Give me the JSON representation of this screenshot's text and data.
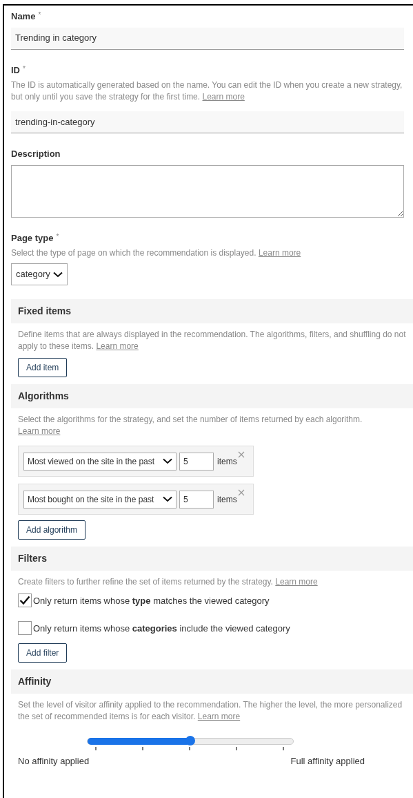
{
  "name_field": {
    "label": "Name",
    "required_mark": "*",
    "value": "Trending in category"
  },
  "id_field": {
    "label": "ID",
    "required_mark": "*",
    "help": "The ID is automatically generated based on the name. You can edit the ID when you create a new strategy, but only until you save the strategy for the first time.",
    "link": "Learn more",
    "value": "trending-in-category"
  },
  "description_field": {
    "label": "Description"
  },
  "page_type": {
    "label": "Page type",
    "required_mark": "*",
    "help": "Select the type of page on which the recommendation is displayed.",
    "link": "Learn more",
    "value": "category"
  },
  "fixed_items": {
    "title": "Fixed items",
    "help": "Define items that are always displayed in the recommendation. The algorithms, filters, and shuffling do not apply to these items.",
    "link": "Learn more",
    "button": "Add item"
  },
  "algorithms": {
    "title": "Algorithms",
    "help": "Select the algorithms for the strategy, and set the number of items returned by each algorithm.",
    "link": "Learn more",
    "rows": [
      {
        "algorithm": "Most viewed on the site in the past",
        "count": "5",
        "unit": "items"
      },
      {
        "algorithm": "Most bought on the site in the past",
        "count": "5",
        "unit": "items"
      }
    ],
    "button": "Add algorithm"
  },
  "filters": {
    "title": "Filters",
    "help": "Create filters to further refine the set of items returned by the strategy.",
    "link": "Learn more",
    "options": [
      {
        "label": "Only return items whose **type** matches the viewed category",
        "checked": true
      },
      {
        "label": "Only return items whose **categories** include the viewed category",
        "checked": false
      }
    ],
    "button": "Add filter"
  },
  "affinity": {
    "title": "Affinity",
    "help": "Set the level of visitor affinity applied to the recommendation. The higher the level, the more personalized the set of recommended items is for each visitor.",
    "link": "Learn more",
    "level": 0.5,
    "min_label": "No affinity applied",
    "max_label": "Full affinity applied"
  }
}
